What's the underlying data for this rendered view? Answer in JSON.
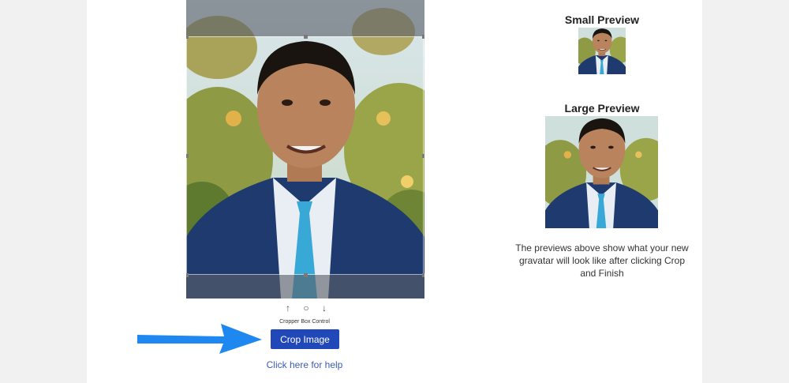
{
  "cropper": {
    "caption": "Cropper Box Control",
    "controls": {
      "up_glyph": "↑",
      "reset_glyph": "○",
      "down_glyph": "↓"
    },
    "crop_button_label": "Crop Image",
    "help_link_label": "Click here for help"
  },
  "previews": {
    "small_title": "Small Preview",
    "large_title": "Large Preview",
    "note": "The previews above show what your new gravatar will look like after clicking Crop and Finish"
  },
  "colors": {
    "button": "#2148b8",
    "link": "#3b5bb5",
    "arrow": "#1e88f0"
  },
  "icons": {
    "pointer": "arrow-right-icon"
  }
}
